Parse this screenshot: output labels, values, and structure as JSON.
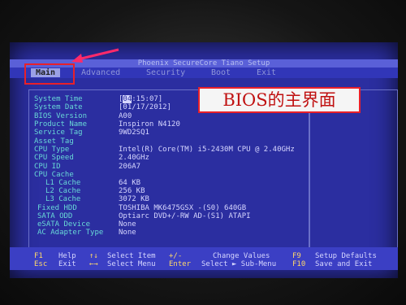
{
  "title": "Phoenix SecureCore Tiano Setup",
  "menu": [
    {
      "label": "Main",
      "active": true
    },
    {
      "label": "Advanced"
    },
    {
      "label": "Security"
    },
    {
      "label": "Boot"
    },
    {
      "label": "Exit"
    }
  ],
  "main": {
    "system_time_label": "System Time",
    "system_time_cursor": "04",
    "system_time_rest": ":15:07]",
    "system_time_open": "[",
    "system_date_label": "System Date",
    "system_date_value": "[01/17/2012]",
    "rows": [
      {
        "label": "BIOS Version",
        "value": "A00"
      },
      {
        "label": "Product Name",
        "value": "Inspiron N4120"
      },
      {
        "label": "Service Tag",
        "value": "9WD2SQ1"
      },
      {
        "label": "Asset Tag",
        "value": ""
      },
      {
        "label": "CPU Type",
        "value": "Intel(R) Core(TM) i5-2430M CPU @ 2.40GHz"
      },
      {
        "label": "CPU Speed",
        "value": "2.40GHz"
      },
      {
        "label": "CPU ID",
        "value": "206A7"
      },
      {
        "label": "CPU Cache",
        "value": ""
      },
      {
        "label": "L1 Cache",
        "value": "64 KB"
      },
      {
        "label": "L2 Cache",
        "value": "256 KB"
      },
      {
        "label": "L3 Cache",
        "value": "3072 KB"
      },
      {
        "label": "Fixed HDD",
        "value": "TOSHIBA MK6475GSX    -(S0) 640GB"
      },
      {
        "label": "SATA ODD",
        "value": "Optiarc DVD+/-RW AD-(S1)   ATAPI"
      },
      {
        "label": "eSATA Device",
        "value": "None"
      },
      {
        "label": "AC Adapter Type",
        "value": "None"
      }
    ]
  },
  "annotation": "BIOS的主界面",
  "bottom": {
    "row1": [
      {
        "key": "F1",
        "desc": "Help"
      },
      {
        "key": "↑↓",
        "desc": "Select Item"
      },
      {
        "key": "+/-",
        "desc": "Change Values"
      },
      {
        "key": "F9",
        "desc": "Setup Defaults"
      }
    ],
    "row2": [
      {
        "key": "Esc",
        "desc": "Exit"
      },
      {
        "key": "←→",
        "desc": "Select Menu"
      },
      {
        "key": "Enter",
        "desc": "Select ► Sub-Menu"
      },
      {
        "key": "F10",
        "desc": "Save and Exit"
      }
    ]
  },
  "colors": {
    "bios_bg": "#2b2ea0",
    "label": "#68d8d6",
    "value": "#d6d6ff",
    "annotation": "#e8202a"
  }
}
